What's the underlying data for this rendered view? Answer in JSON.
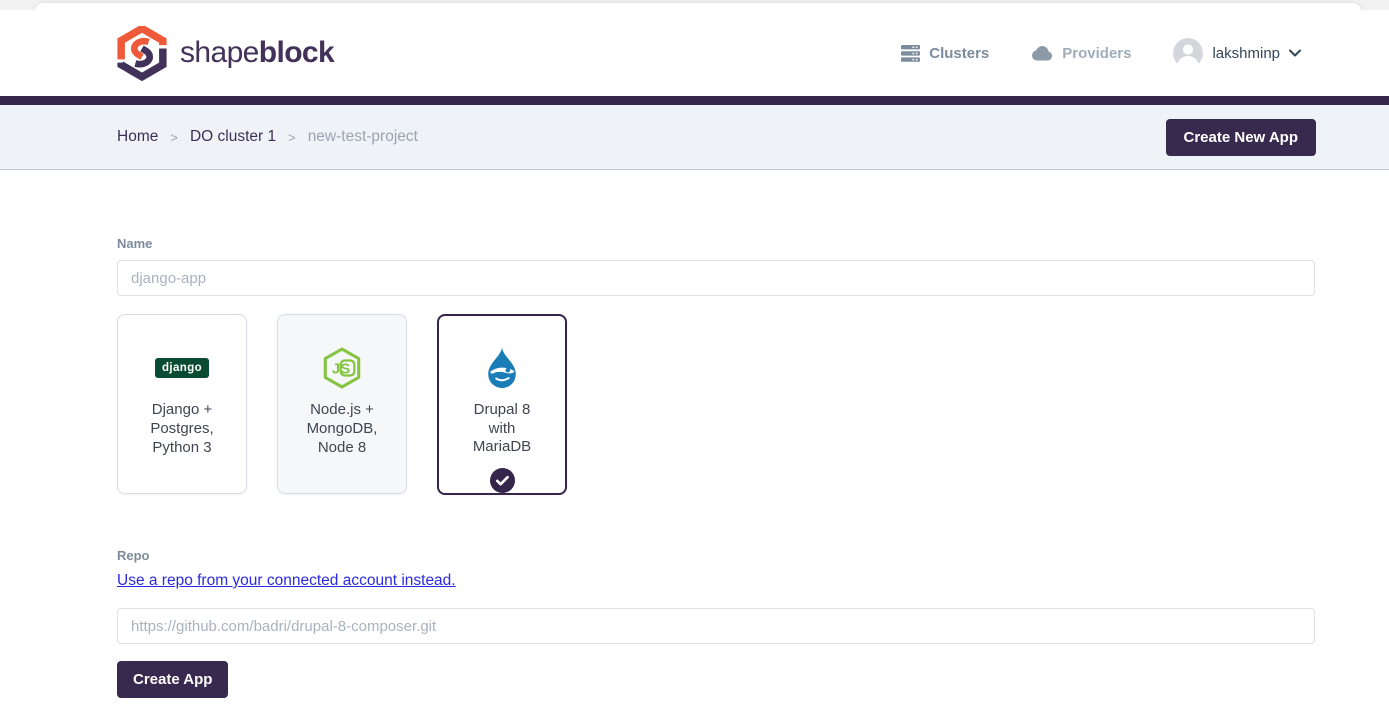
{
  "header": {
    "brand": {
      "shape": "shape",
      "block": "block",
      "logo_icon": "shapeblock-hexagon-logo"
    },
    "nav": [
      {
        "label": "Clusters",
        "icon": "server-stack-icon"
      },
      {
        "label": "Providers",
        "icon": "cloud-icon"
      }
    ],
    "user": {
      "name": "lakshminp",
      "avatar_icon": "person-avatar",
      "chevron_icon": "chevron-down-icon"
    }
  },
  "breadcrumb": {
    "separator": ">",
    "items": [
      {
        "label": "Home",
        "type": "link"
      },
      {
        "label": "DO cluster 1",
        "type": "link"
      },
      {
        "label": "new-test-project",
        "type": "current"
      }
    ]
  },
  "actions": {
    "create_new_app": "Create New App",
    "create_app": "Create App"
  },
  "form": {
    "name": {
      "label": "Name",
      "placeholder": "django-app",
      "value": ""
    },
    "stacks": [
      {
        "label": "Django + Postgres, Python 3",
        "icon": "django-logo",
        "badge_text": "django",
        "selected": false
      },
      {
        "label": "Node.js + MongoDB, Node 8",
        "icon": "nodejs-logo",
        "logo_text": "JS",
        "selected": false
      },
      {
        "label": "Drupal 8 with MariaDB",
        "icon": "drupal-logo",
        "selected": true,
        "selected_icon": "check-circle-icon"
      }
    ],
    "repo": {
      "label": "Repo",
      "link": "Use a repo from your connected account instead.",
      "placeholder": "https://github.com/badri/drupal-8-composer.git",
      "value": ""
    }
  },
  "colors": {
    "brand_purple": "#35254a",
    "button_purple": "#372a4e",
    "brand_orange": "#ee5a3a",
    "link_blue": "#2a2ae0",
    "node_green": "#85c440",
    "drupal_blue": "#1b7db8",
    "django_green": "#0c4b33",
    "breadcrumb_bg": "#eff2f6"
  }
}
